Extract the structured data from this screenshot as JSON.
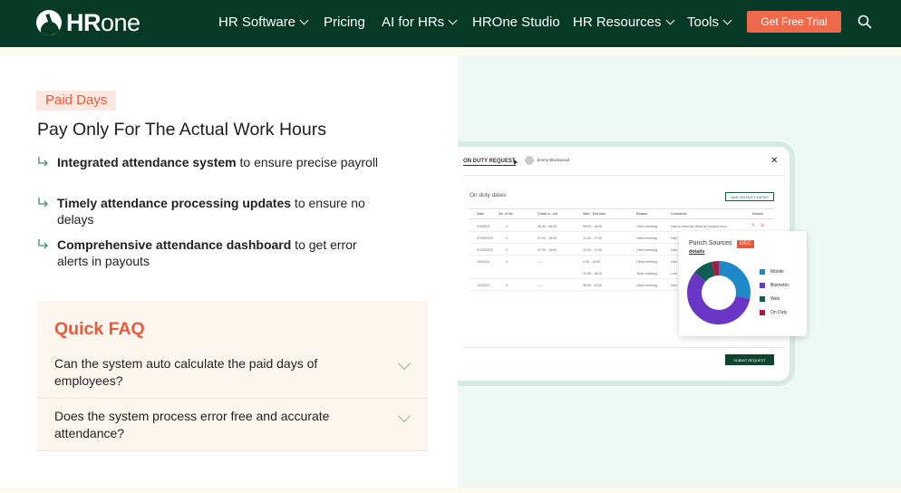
{
  "nav": {
    "brand_bold": "HR",
    "brand_light": "one",
    "items": [
      {
        "label": "HR Software",
        "has_dropdown": true
      },
      {
        "label": "Pricing",
        "has_dropdown": false
      },
      {
        "label": "AI for HRs",
        "has_dropdown": true
      },
      {
        "label": "HROne Studio",
        "has_dropdown": false
      },
      {
        "label": "HR Resources",
        "has_dropdown": true
      },
      {
        "label": "Tools",
        "has_dropdown": true
      }
    ],
    "cta_label": "Get Free Trial",
    "search_icon": "search-icon",
    "colors": {
      "bg": "#063a26",
      "cta": "#ef6a4c"
    }
  },
  "feature": {
    "tag": "Paid Days",
    "heading": "Pay Only For The Actual Work Hours",
    "bullets": [
      {
        "bold": "Integrated attendance system",
        "rest": " to ensure precise payroll"
      },
      {
        "bold": "Timely attendance processing updates",
        "rest": " to ensure no delays"
      },
      {
        "bold": "Comprehensive attendance dashboard",
        "rest": " to get error alerts in payouts"
      }
    ]
  },
  "faq": {
    "title": "Quick FAQ",
    "questions": [
      "Can the system auto calculate the paid days of employees?",
      "Does the system process error free and accurate attendance?"
    ]
  },
  "mockup": {
    "title": "ON DUTY REQUEST",
    "user": "Jimmy Blackwood",
    "section_title": "On duty dates",
    "add_button": "ADD ON DUTY DATES",
    "columns": [
      "Date",
      "No. of hrs",
      "Check in - out",
      "Start - End time",
      "Reason",
      "Comments",
      "Actions"
    ],
    "rows": [
      [
        "04/05/23",
        "0",
        "06:30 - 08:30",
        "08:00 - 18:00",
        "Client meeting",
        "Had to meet the client for product reco..."
      ],
      [
        "07/05/2023",
        "0",
        "07:00 - 16:00",
        "10:00 - 17:00",
        "Client meeting",
        "Had"
      ],
      [
        "07/05/2023",
        "0",
        "07:00 - 16:00",
        "10:00 - 17:00",
        "Client meeting",
        "Had"
      ],
      [
        "10/05/23",
        "0",
        "--:--",
        "4:30 - 12:00",
        "Client meeting",
        "Had"
      ],
      [
        "",
        "",
        "",
        "13:00 - 18:00",
        "Team meeting",
        "Lore"
      ],
      [
        "11/05/23",
        "0",
        "--:--",
        "06:00 - 12:00",
        "Client meeting",
        "Had"
      ]
    ],
    "submit_button": "SUBMIT REQUEST",
    "card": {
      "title": "Punch Sources",
      "badge": "DEC",
      "sub": "details",
      "legend": [
        {
          "label": "Mobile",
          "color": "#1e88c9"
        },
        {
          "label": "Biometric",
          "color": "#6a36c6"
        },
        {
          "label": "Web",
          "color": "#0f5d52"
        },
        {
          "label": "On Duty",
          "color": "#a31d4a"
        }
      ],
      "shares": [
        0.28,
        0.58,
        0.1,
        0.04
      ]
    }
  }
}
